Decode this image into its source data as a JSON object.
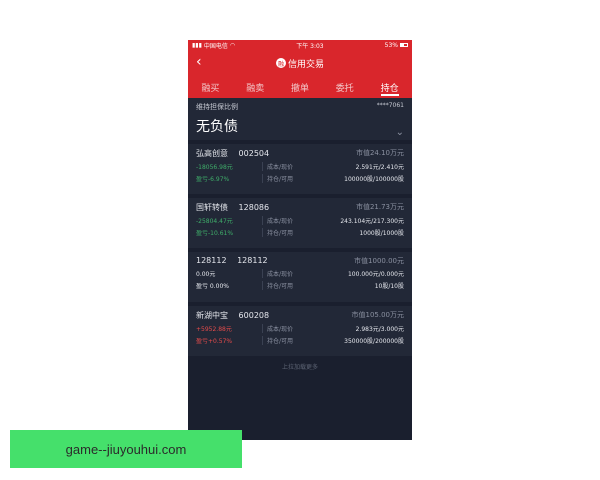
{
  "status_bar": {
    "carrier": "中国电信",
    "time": "下午 3:03",
    "battery": "53%"
  },
  "nav": {
    "badge": "融",
    "title": "信用交易"
  },
  "tabs": [
    {
      "label": "融买"
    },
    {
      "label": "融卖"
    },
    {
      "label": "撤单"
    },
    {
      "label": "委托"
    },
    {
      "label": "持仓"
    }
  ],
  "summary": {
    "label": "维持担保比例",
    "account": "****7061",
    "value": "无负债"
  },
  "positions": [
    {
      "name": "弘高创意",
      "code": "002504",
      "market_value": "市值24.10万元",
      "pl_amount": "-18056.98元",
      "pl_percent": "盈亏-6.97%",
      "cost_label": "成本/现价",
      "hold_label": "持仓/可用",
      "cost_value": "2.591元/2.410元",
      "hold_value": "100000股/100000股"
    },
    {
      "name": "国轩转债",
      "code": "128086",
      "market_value": "市值21.73万元",
      "pl_amount": "-25804.47元",
      "pl_percent": "盈亏-10.61%",
      "cost_label": "成本/现价",
      "hold_label": "持仓/可用",
      "cost_value": "243.104元/217.300元",
      "hold_value": "1000股/1000股"
    },
    {
      "name": "128112",
      "code": "128112",
      "market_value": "市值1000.00元",
      "pl_amount": "0.00元",
      "pl_percent": "盈亏 0.00%",
      "cost_label": "成本/现价",
      "hold_label": "持仓/可用",
      "cost_value": "100.000元/0.000元",
      "hold_value": "10股/10股"
    },
    {
      "name": "新湖中宝",
      "code": "600208",
      "market_value": "市值105.00万元",
      "pl_amount": "+5952.88元",
      "pl_percent": "盈亏+0.57%",
      "cost_label": "成本/现价",
      "hold_label": "持仓/可用",
      "cost_value": "2.983元/3.000元",
      "hold_value": "350000股/200000股"
    }
  ],
  "footer": "上拉加载更多",
  "watermark": "game--jiuyouhui.com",
  "colors": {
    "brand_red": "#d9262c",
    "loss_green": "#3fae6a",
    "gain_red": "#e64b4b"
  }
}
